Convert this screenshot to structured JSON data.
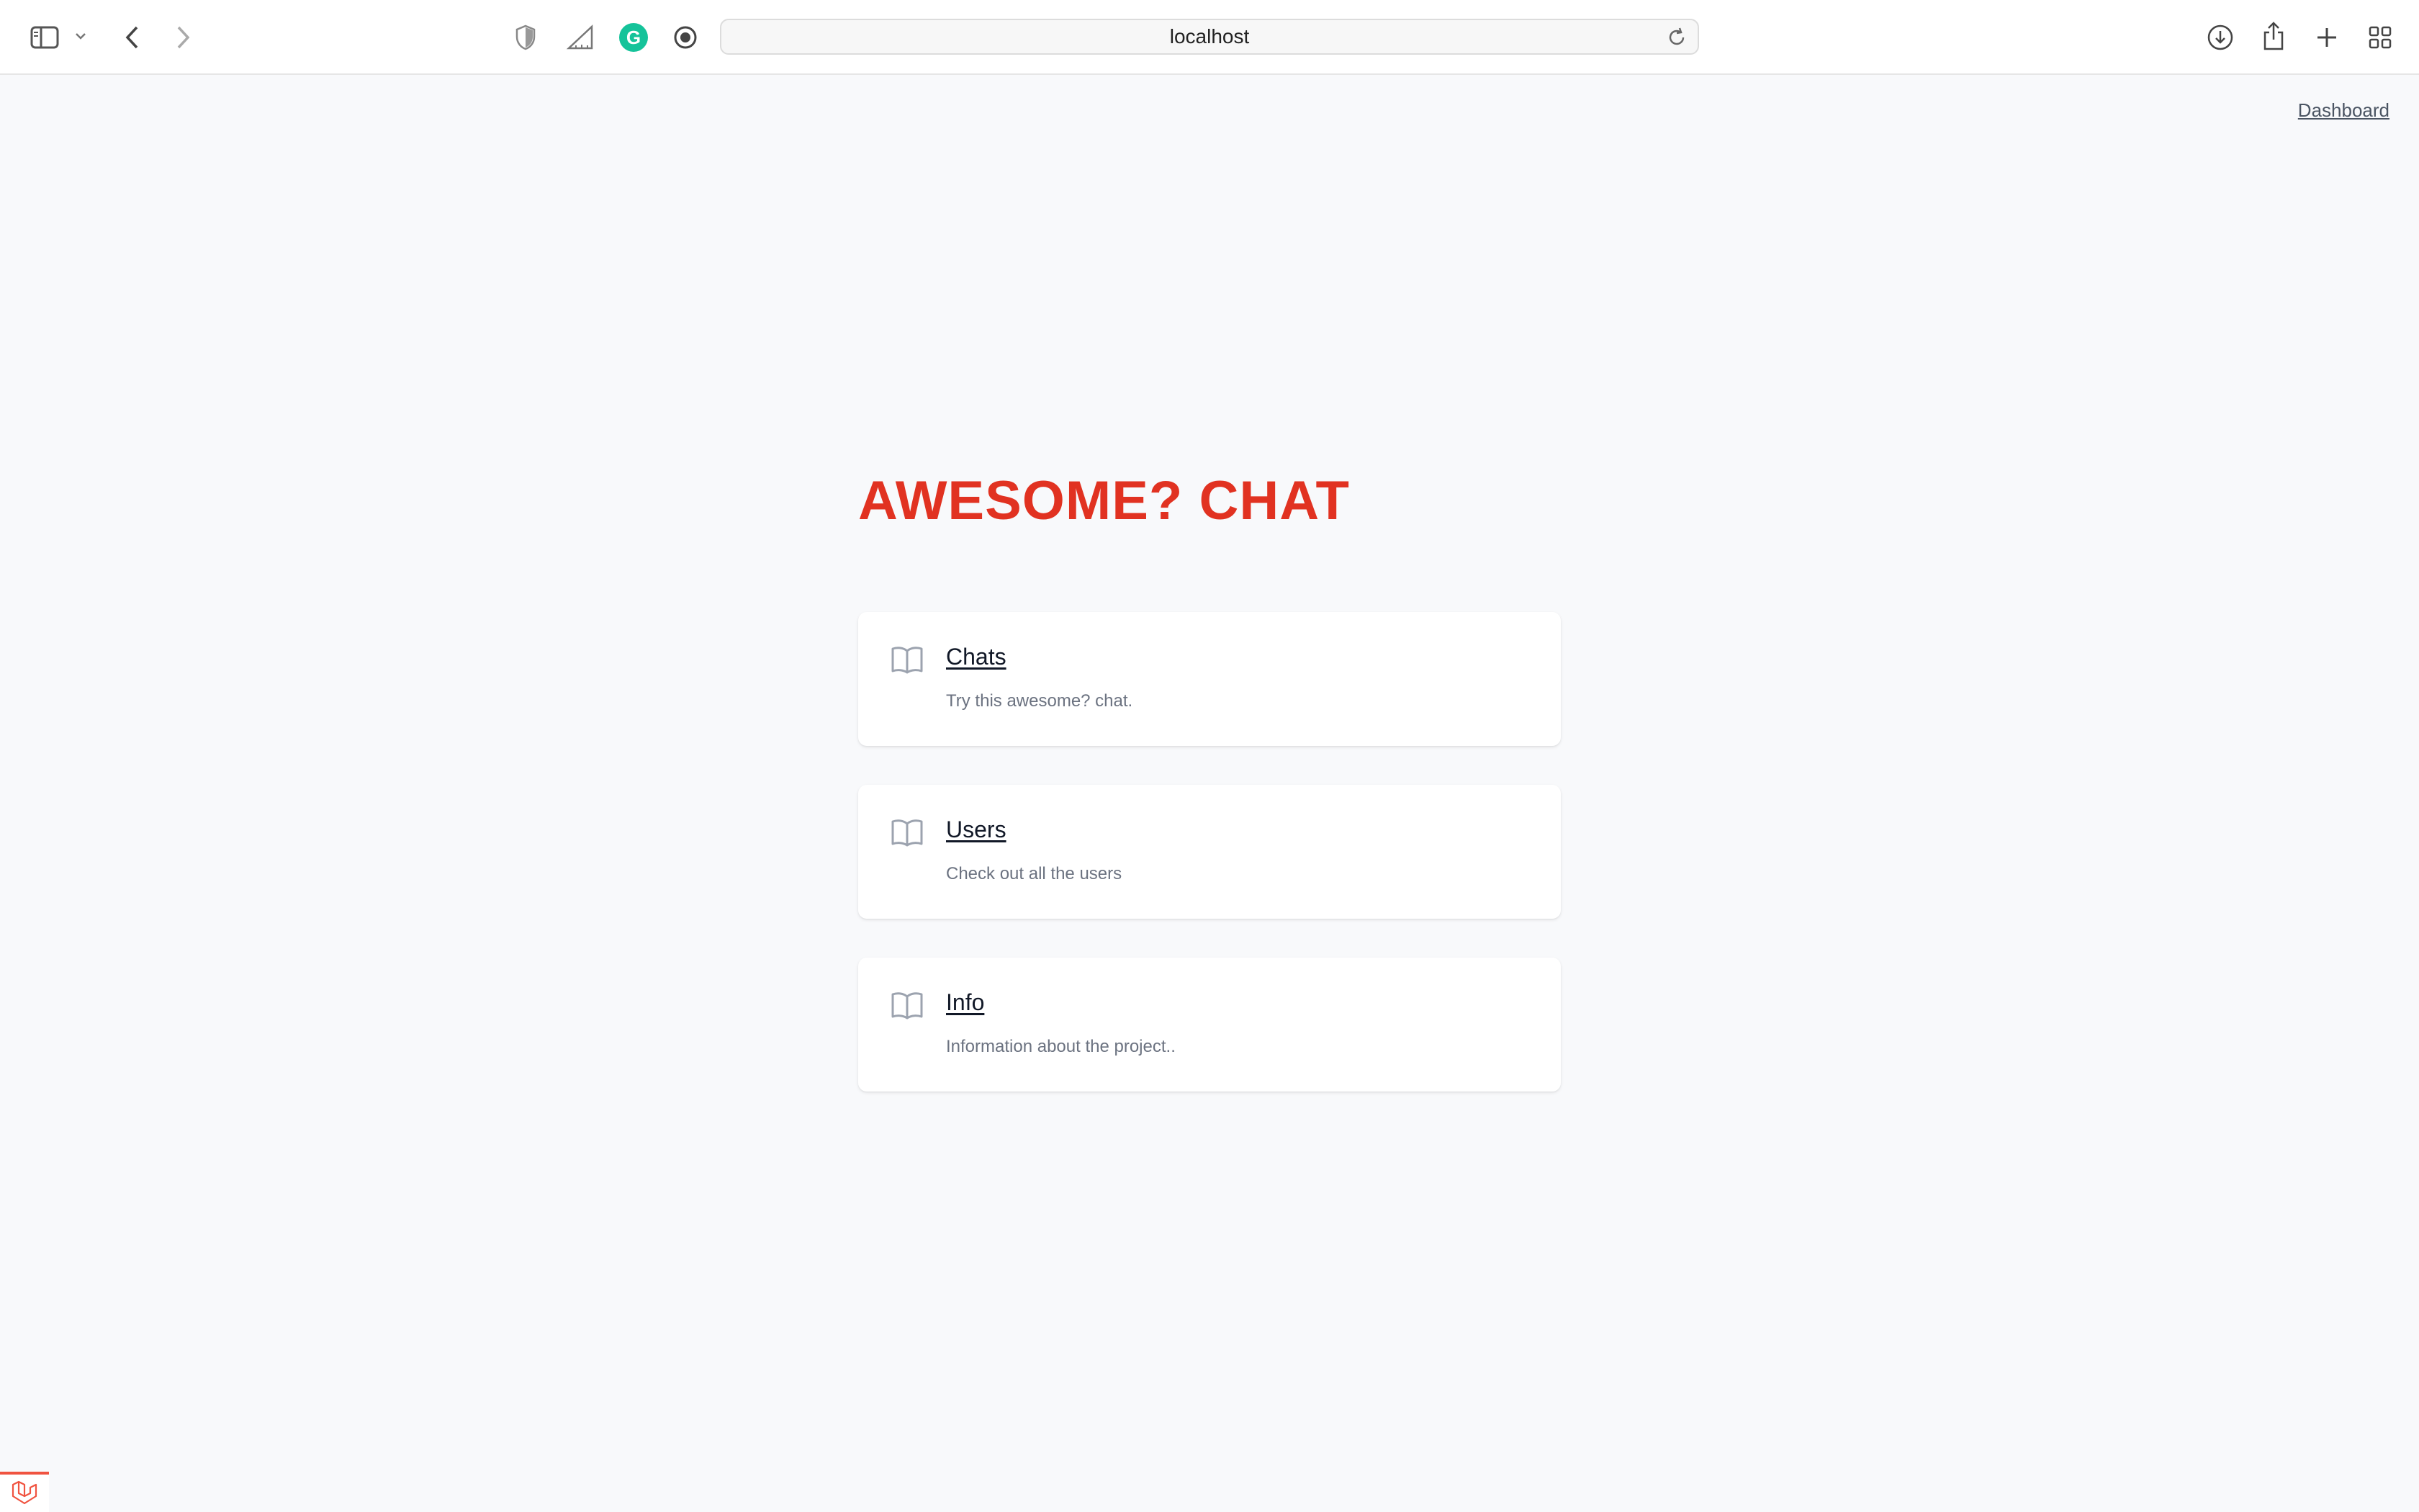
{
  "browser": {
    "address": "localhost",
    "icons": {
      "sidebar": "sidebar-icon",
      "chevron": "chevron-down-icon",
      "back": "back-arrow-icon",
      "forward": "forward-arrow-icon",
      "privacy": "shield-icon",
      "ext1": "ruler-icon",
      "grammarly": "G",
      "ext2": "record-icon",
      "reload": "reload-icon",
      "download": "download-icon",
      "share": "share-icon",
      "newtab": "plus-icon",
      "tabs": "grid-icon"
    }
  },
  "nav": {
    "dashboard": "Dashboard"
  },
  "hero": {
    "title": "AWESOME? CHAT"
  },
  "cards": [
    {
      "title": "Chats",
      "description": "Try this awesome? chat.",
      "icon": "book-icon"
    },
    {
      "title": "Users",
      "description": "Check out all the users",
      "icon": "book-icon"
    },
    {
      "title": "Info",
      "description": "Information about the project..",
      "icon": "book-icon"
    }
  ],
  "colors": {
    "accent": "#e13221",
    "background": "#f8f9fb",
    "card": "#ffffff",
    "muted_text": "#6b7280",
    "icon": "#9ca3af",
    "grammarly": "#15c39a",
    "debug_bar": "#f05340"
  }
}
